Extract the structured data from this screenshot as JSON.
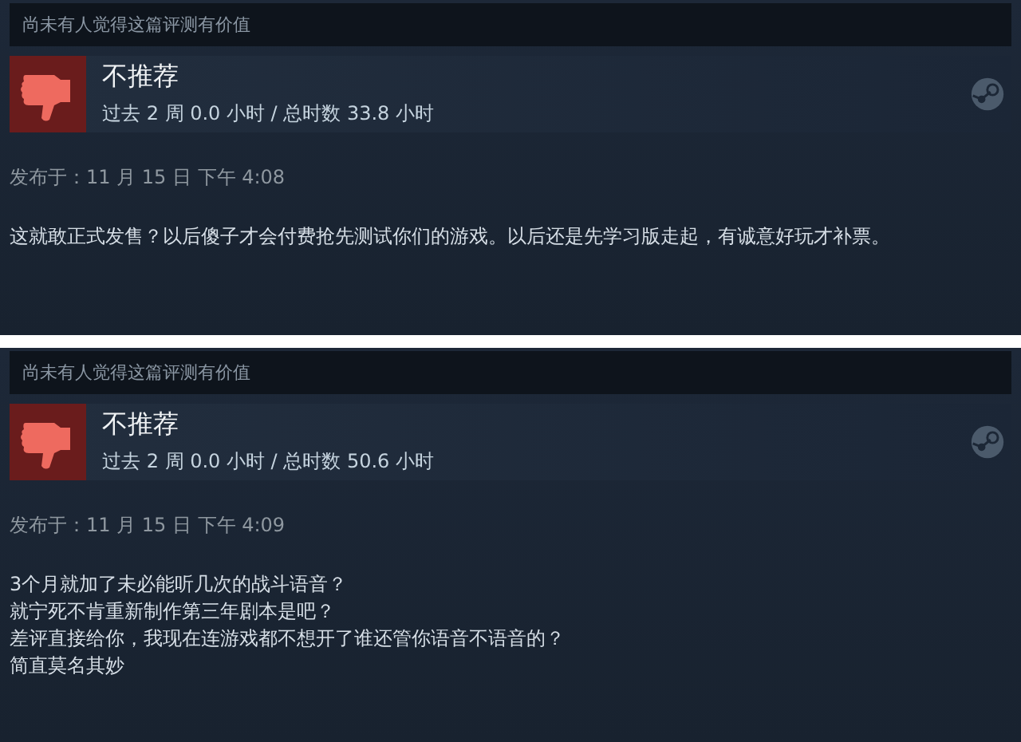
{
  "reviews": [
    {
      "helpful": "尚未有人觉得这篇评测有价值",
      "recommended": false,
      "verdict": "不推荐",
      "hours": "过去 2 周 0.0 小时 / 总时数 33.8 小时",
      "posted": "发布于：11 月 15 日 下午 4:08",
      "body": [
        "这就敢正式发售？以后傻子才会付费抢先测试你们的游戏。以后还是先学习版走起，有诚意好玩才补票。"
      ]
    },
    {
      "helpful": "尚未有人觉得这篇评测有价值",
      "recommended": false,
      "verdict": "不推荐",
      "hours": "过去 2 周 0.0 小时 / 总时数 50.6 小时",
      "posted": "发布于：11 月 15 日 下午 4:09",
      "body": [
        "3个月就加了未必能听几次的战斗语音？",
        "就宁死不肯重新制作第三年剧本是吧？",
        "差评直接给你，我现在连游戏都不想开了谁还管你语音不语音的？",
        "简直莫名其妙"
      ]
    }
  ]
}
